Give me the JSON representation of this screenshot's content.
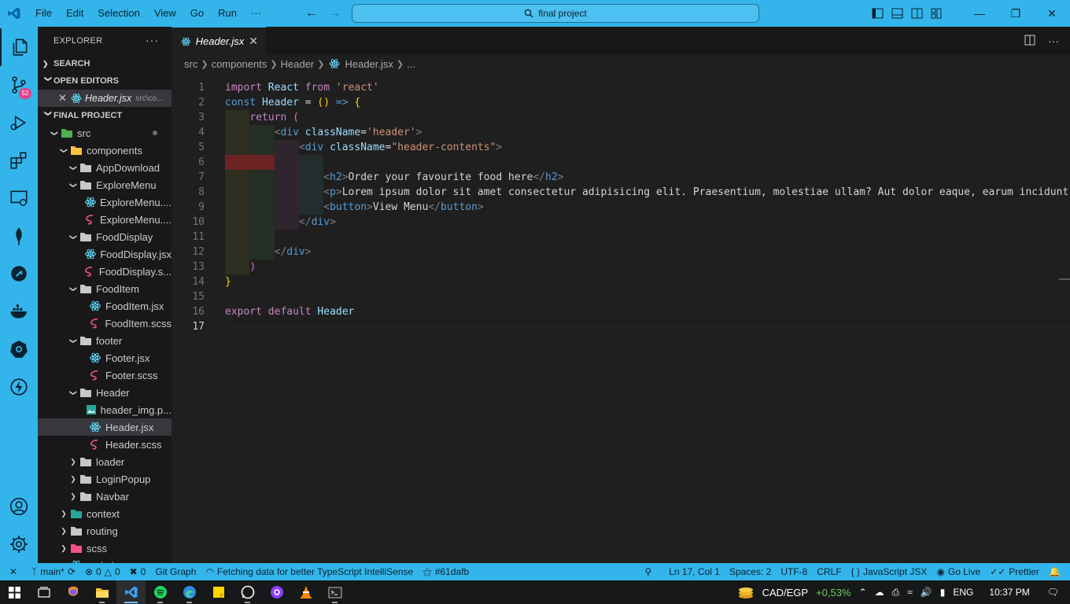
{
  "window": {
    "menu": [
      "File",
      "Edit",
      "Selection",
      "View",
      "Go",
      "Run",
      "···"
    ],
    "search": "final project",
    "colors": {
      "chrome": "#33b5eb",
      "editor_bg": "#1f1f1f",
      "sidebar_bg": "#181818",
      "badge": "#e5408a"
    }
  },
  "activity": {
    "source_control_badge": "52"
  },
  "sidebar": {
    "header": "EXPLORER",
    "more": "···",
    "search_section": "SEARCH",
    "open_editors_section": "OPEN EDITORS",
    "open_editor": {
      "name": "Header.jsx",
      "path": "src\\co..."
    },
    "project_section": "FINAL PROJECT",
    "tree": [
      {
        "label": "src",
        "kind": "folder-src",
        "depth": 1,
        "state": "open"
      },
      {
        "label": "components",
        "kind": "folder-components",
        "depth": 2,
        "state": "open"
      },
      {
        "label": "AppDownload",
        "kind": "folder",
        "depth": 3,
        "state": "open"
      },
      {
        "label": "ExploreMenu",
        "kind": "folder",
        "depth": 3,
        "state": "open"
      },
      {
        "label": "ExploreMenu....",
        "kind": "react",
        "depth": 4,
        "state": "file"
      },
      {
        "label": "ExploreMenu....",
        "kind": "sass",
        "depth": 4,
        "state": "file"
      },
      {
        "label": "FoodDisplay",
        "kind": "folder",
        "depth": 3,
        "state": "open"
      },
      {
        "label": "FoodDisplay.jsx",
        "kind": "react",
        "depth": 4,
        "state": "file"
      },
      {
        "label": "FoodDisplay.s...",
        "kind": "sass",
        "depth": 4,
        "state": "file"
      },
      {
        "label": "FoodItem",
        "kind": "folder",
        "depth": 3,
        "state": "open"
      },
      {
        "label": "FoodItem.jsx",
        "kind": "react",
        "depth": 4,
        "state": "file"
      },
      {
        "label": "FoodItem.scss",
        "kind": "sass",
        "depth": 4,
        "state": "file"
      },
      {
        "label": "footer",
        "kind": "folder",
        "depth": 3,
        "state": "open"
      },
      {
        "label": "Footer.jsx",
        "kind": "react",
        "depth": 4,
        "state": "file"
      },
      {
        "label": "Footer.scss",
        "kind": "sass",
        "depth": 4,
        "state": "file"
      },
      {
        "label": "Header",
        "kind": "folder",
        "depth": 3,
        "state": "open"
      },
      {
        "label": "header_img.p...",
        "kind": "image",
        "depth": 4,
        "state": "file"
      },
      {
        "label": "Header.jsx",
        "kind": "react",
        "depth": 4,
        "state": "file",
        "selected": true
      },
      {
        "label": "Header.scss",
        "kind": "sass",
        "depth": 4,
        "state": "file"
      },
      {
        "label": "loader",
        "kind": "folder",
        "depth": 3,
        "state": "closed"
      },
      {
        "label": "LoginPopup",
        "kind": "folder",
        "depth": 3,
        "state": "closed"
      },
      {
        "label": "Navbar",
        "kind": "folder",
        "depth": 3,
        "state": "closed"
      },
      {
        "label": "context",
        "kind": "folder-context",
        "depth": 2,
        "state": "closed"
      },
      {
        "label": "routing",
        "kind": "folder",
        "depth": 2,
        "state": "closed"
      },
      {
        "label": "scss",
        "kind": "folder-sass",
        "depth": 2,
        "state": "closed"
      },
      {
        "label": "main.jsx",
        "kind": "react",
        "depth": 2,
        "state": "file"
      }
    ]
  },
  "editor": {
    "tab": "Header.jsx",
    "breadcrumb": [
      "src",
      "components",
      "Header",
      "Header.jsx",
      "..."
    ],
    "current_line": 17,
    "lines": [
      [
        [
          "import",
          "c"
        ],
        [
          " ",
          "w"
        ],
        [
          "React",
          "v"
        ],
        [
          " ",
          "w"
        ],
        [
          "from",
          "c"
        ],
        [
          " ",
          "w"
        ],
        [
          "'react'",
          "s"
        ]
      ],
      [
        [
          "const",
          "k"
        ],
        [
          " ",
          "w"
        ],
        [
          "Header",
          "v"
        ],
        [
          " = ",
          "w"
        ],
        [
          "()",
          "y"
        ],
        [
          " ",
          "w"
        ],
        [
          "=>",
          "k"
        ],
        [
          " ",
          "w"
        ],
        [
          "{",
          "y"
        ]
      ],
      [
        [
          "    ",
          "w"
        ],
        [
          "return",
          "c"
        ],
        [
          " ",
          "w"
        ],
        [
          "(",
          "p"
        ]
      ],
      [
        [
          "        ",
          "w"
        ],
        [
          "<",
          "g"
        ],
        [
          "div",
          "t"
        ],
        [
          " ",
          "w"
        ],
        [
          "className",
          "a"
        ],
        [
          "=",
          "w"
        ],
        [
          "'header'",
          "s"
        ],
        [
          ">",
          "g"
        ]
      ],
      [
        [
          "            ",
          "w"
        ],
        [
          "<",
          "g"
        ],
        [
          "div",
          "t"
        ],
        [
          " ",
          "w"
        ],
        [
          "className",
          "a"
        ],
        [
          "=",
          "w"
        ],
        [
          "\"header-contents\"",
          "s"
        ],
        [
          ">",
          "g"
        ]
      ],
      [],
      [
        [
          "                ",
          "w"
        ],
        [
          "<",
          "g"
        ],
        [
          "h2",
          "t"
        ],
        [
          ">",
          "g"
        ],
        [
          "Order your favourite food here",
          "w"
        ],
        [
          "</",
          "g"
        ],
        [
          "h2",
          "t"
        ],
        [
          ">",
          "g"
        ]
      ],
      [
        [
          "                ",
          "w"
        ],
        [
          "<",
          "g"
        ],
        [
          "p",
          "t"
        ],
        [
          ">",
          "g"
        ],
        [
          "Lorem ipsum dolor sit amet consectetur adipisicing elit. Praesentium, molestiae ullam? Aut dolor eaque, earum incidunt, vitae",
          "w"
        ]
      ],
      [
        [
          "                ",
          "w"
        ],
        [
          "<",
          "g"
        ],
        [
          "button",
          "t"
        ],
        [
          ">",
          "g"
        ],
        [
          "View Menu",
          "w"
        ],
        [
          "</",
          "g"
        ],
        [
          "button",
          "t"
        ],
        [
          ">",
          "g"
        ]
      ],
      [
        [
          "            ",
          "w"
        ],
        [
          "</",
          "g"
        ],
        [
          "div",
          "t"
        ],
        [
          ">",
          "g"
        ]
      ],
      [],
      [
        [
          "        ",
          "w"
        ],
        [
          "</",
          "g"
        ],
        [
          "div",
          "t"
        ],
        [
          ">",
          "g"
        ]
      ],
      [
        [
          "    ",
          "w"
        ],
        [
          ")",
          "p"
        ]
      ],
      [
        [
          "}",
          "y"
        ]
      ],
      [],
      [
        [
          "export",
          "c"
        ],
        [
          " ",
          "w"
        ],
        [
          "default",
          "c"
        ],
        [
          " ",
          "w"
        ],
        [
          "Header",
          "v"
        ]
      ],
      []
    ]
  },
  "statusbar": {
    "branch": "main*",
    "errors": "0",
    "warnings": "0",
    "ports": "0",
    "git_graph": "Git Graph",
    "task": "Fetching data for better TypeScript IntelliSense",
    "commit": "#61dafb",
    "position": "Ln 17, Col 1",
    "spaces": "Spaces: 2",
    "encoding": "UTF-8",
    "eol": "CRLF",
    "language": "JavaScript JSX",
    "golive": "Go Live",
    "prettier": "Prettier"
  },
  "taskbar": {
    "currency": "CAD/EGP",
    "change": "+0,53%",
    "lang": "ENG",
    "time": "10:37 PM"
  }
}
